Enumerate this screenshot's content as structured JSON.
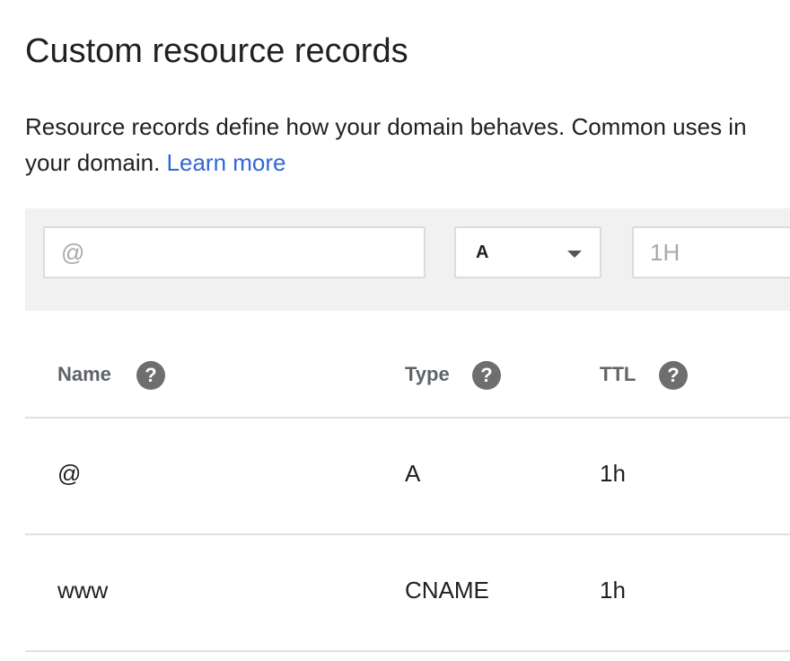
{
  "page": {
    "title": "Custom resource records",
    "description_line1": "Resource records define how your domain behaves. Common uses in",
    "description_line2": "your domain.",
    "learn_more": "Learn more"
  },
  "form": {
    "name_placeholder": "@",
    "type_value": "A",
    "ttl_placeholder": "1H"
  },
  "table": {
    "headers": {
      "name": "Name",
      "type": "Type",
      "ttl": "TTL"
    },
    "help_glyph": "?",
    "rows": [
      {
        "name": "@",
        "type": "A",
        "ttl": "1h"
      },
      {
        "name": "www",
        "type": "CNAME",
        "ttl": "1h"
      }
    ]
  },
  "colors": {
    "link": "#3367d6",
    "toolbar_bg": "#f1f1f1",
    "help_icon": "#6e6e6e"
  },
  "icons": {
    "help": "help-circle-icon",
    "dropdown": "caret-down-icon"
  }
}
